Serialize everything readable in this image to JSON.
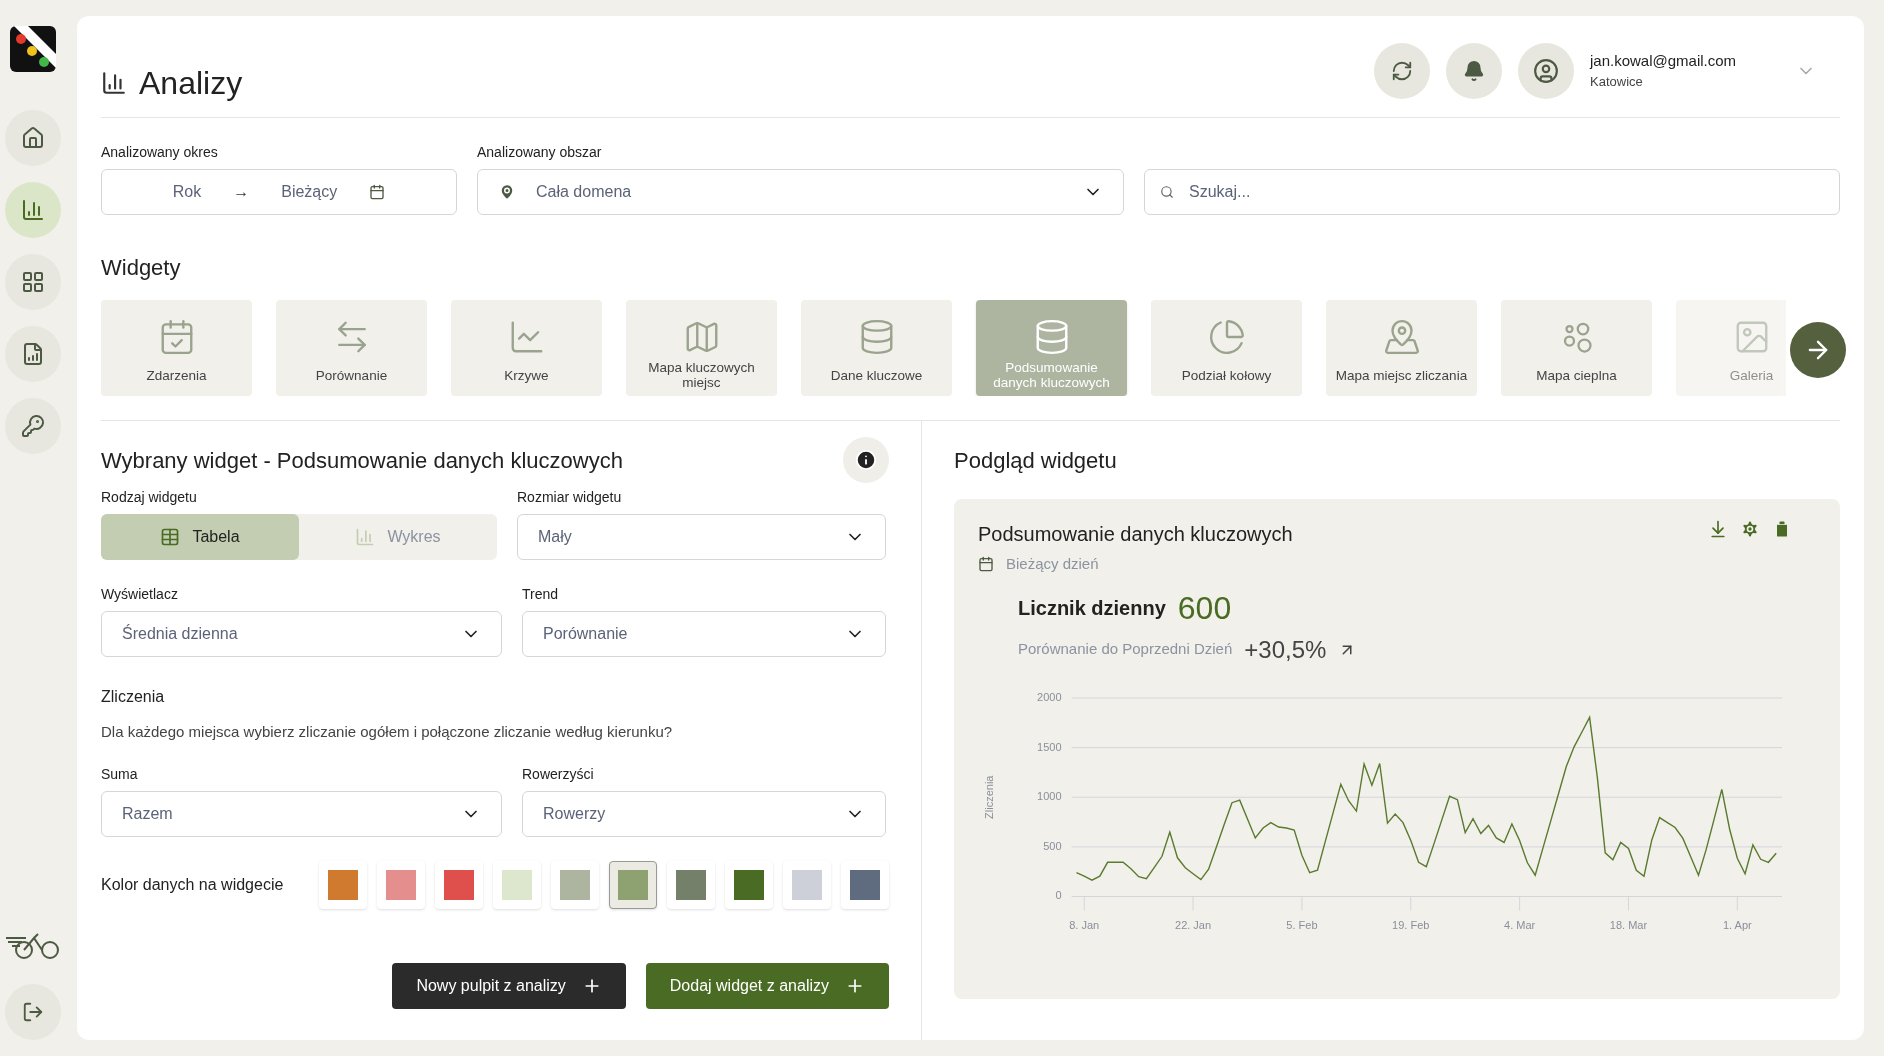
{
  "sidebar": {
    "items": [
      {
        "selected": false
      },
      {
        "selected": true
      },
      {
        "selected": false
      },
      {
        "selected": false
      },
      {
        "selected": false
      }
    ]
  },
  "header": {
    "title": "Analizy",
    "user": {
      "email": "jan.kowal@gmail.com",
      "city": "Katowice"
    }
  },
  "filters": {
    "period": {
      "label": "Analizowany okres",
      "from": "Rok",
      "arrow": "→",
      "to": "Bieżący"
    },
    "area": {
      "label": "Analizowany obszar",
      "value": "Cała domena"
    },
    "search": {
      "placeholder": "Szukaj..."
    }
  },
  "widgets": {
    "title": "Widgety",
    "items": [
      {
        "label": "Zdarzenia",
        "selected": false,
        "faded": false
      },
      {
        "label": "Porównanie",
        "selected": false,
        "faded": false
      },
      {
        "label": "Krzywe",
        "selected": false,
        "faded": false
      },
      {
        "label": "Mapa kluczowych miejsc",
        "selected": false,
        "faded": false
      },
      {
        "label": "Dane kluczowe",
        "selected": false,
        "faded": false
      },
      {
        "label": "Podsumowanie danych kluczowych",
        "selected": true,
        "faded": false
      },
      {
        "label": "Podział kołowy",
        "selected": false,
        "faded": false
      },
      {
        "label": "Mapa miejsc zliczania",
        "selected": false,
        "faded": false
      },
      {
        "label": "Mapa cieplna",
        "selected": false,
        "faded": false
      },
      {
        "label": "Galeria",
        "selected": false,
        "faded": true
      }
    ]
  },
  "config": {
    "title": "Wybrany widget - Podsumowanie danych kluczowych",
    "type": {
      "label": "Rodzaj widgetu",
      "options": [
        {
          "label": "Tabela",
          "selected": true
        },
        {
          "label": "Wykres",
          "selected": false
        }
      ]
    },
    "size": {
      "label": "Rozmiar widgetu",
      "value": "Mały"
    },
    "display": {
      "label": "Wyświetlacz",
      "value": "Średnia dzienna"
    },
    "trend": {
      "label": "Trend",
      "value": "Porównanie"
    },
    "counts": {
      "title": "Zliczenia",
      "description": "Dla każdego miejsca wybierz zliczanie ogółem i połączone zliczanie według kierunku?"
    },
    "sum": {
      "label": "Suma",
      "value": "Razem"
    },
    "cyclists": {
      "label": "Rowerzyści",
      "value": "Rowerzy"
    },
    "colors": {
      "label": "Kolor danych na widgecie",
      "swatches": [
        {
          "color": "#cf7a2e",
          "selected": false
        },
        {
          "color": "#e48f8d",
          "selected": false
        },
        {
          "color": "#df4f4b",
          "selected": false
        },
        {
          "color": "#dde7cd",
          "selected": false
        },
        {
          "color": "#adb5a0",
          "selected": false
        },
        {
          "color": "#8ea271",
          "selected": true
        },
        {
          "color": "#74806a",
          "selected": false
        },
        {
          "color": "#4a6b23",
          "selected": false
        },
        {
          "color": "#cdd0d9",
          "selected": false
        },
        {
          "color": "#5f6c80",
          "selected": false
        }
      ]
    },
    "buttons": [
      {
        "label": "Nowy pulpit z analizy",
        "kind": "dark"
      },
      {
        "label": "Dodaj widget z analizy",
        "kind": "green"
      }
    ]
  },
  "preview": {
    "title": "Podgląd widgetu",
    "card": {
      "title": "Podsumowanie danych kluczowych",
      "period": "Bieżący dzień",
      "metric_label": "Licznik dzienny",
      "metric_value": "600",
      "comparison_label": "Porównanie do Poprzedni Dzień",
      "comparison_value": "+30,5%",
      "chart_data": {
        "type": "line",
        "grid": true,
        "ylabel": "Zliczenia",
        "ylim": [
          0,
          2000
        ],
        "yticks": [
          0,
          500,
          1000,
          1500,
          2000
        ],
        "categories": [
          null,
          null,
          null,
          "8. Jan",
          null,
          null,
          null,
          null,
          null,
          null,
          null,
          null,
          null,
          null,
          null,
          null,
          null,
          "22. Jan",
          null,
          null,
          null,
          null,
          null,
          null,
          null,
          null,
          null,
          null,
          null,
          null,
          null,
          "5. Feb",
          null,
          null,
          null,
          null,
          null,
          null,
          null,
          null,
          null,
          null,
          null,
          null,
          null,
          "19. Feb",
          null,
          null,
          null,
          null,
          null,
          null,
          null,
          null,
          null,
          null,
          null,
          null,
          null,
          "4. Mar",
          null,
          null,
          null,
          null,
          null,
          null,
          null,
          null,
          null,
          null,
          null,
          null,
          null,
          "18. Mar",
          null,
          null,
          null,
          null,
          null,
          null,
          null,
          null,
          null,
          null,
          null,
          null,
          null,
          "1. Apr",
          null,
          null,
          null,
          null,
          null
        ],
        "series": [
          {
            "color": "#5a7a2e",
            "values": [
              null,
              null,
              240,
              205,
              165,
              205,
              345,
              345,
              345,
              280,
              200,
              180,
              290,
              405,
              650,
              390,
              290,
              230,
              170,
              275,
              500,
              725,
              945,
              970,
              780,
              590,
              690,
              745,
              700,
              690,
              670,
              415,
              240,
              265,
              555,
              840,
              1130,
              965,
              860,
              1335,
              1120,
              1340,
              740,
              830,
              745,
              565,
              345,
              300,
              535,
              775,
              1010,
              975,
              645,
              785,
              635,
              715,
              590,
              545,
              730,
              565,
              340,
              215,
              490,
              760,
              1035,
              1310,
              1505,
              1655,
              1805,
              1195,
              440,
              370,
              545,
              485,
              265,
              205,
              570,
              795,
              745,
              695,
              585,
              400,
              215,
              475,
              775,
              1080,
              680,
              385,
              230,
              520,
              375,
              345,
              435
            ]
          }
        ]
      }
    }
  }
}
